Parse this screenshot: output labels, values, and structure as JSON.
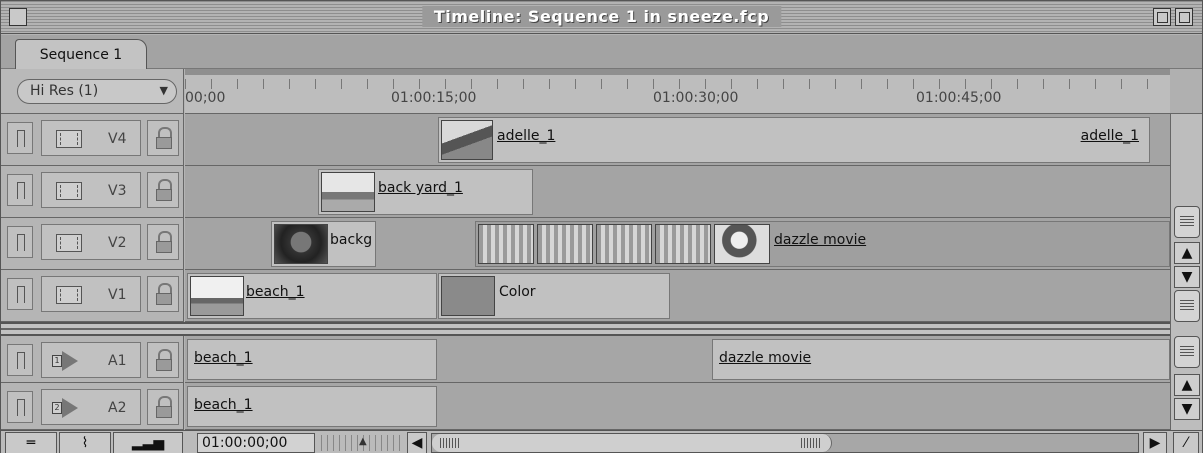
{
  "window": {
    "title": "Timeline: Sequence 1  in sneeze.fcp"
  },
  "tabs": [
    {
      "label": "Sequence 1"
    }
  ],
  "resolution": {
    "label": "Hi Res  (1)",
    "dropdown_icon": "▼"
  },
  "ruler": {
    "timecodes": [
      "00;00",
      "01:00:15;00",
      "01:00:30;00",
      "01:00:45;00"
    ]
  },
  "tracks": {
    "video": [
      {
        "name": "V4",
        "clips": [
          {
            "label": "adelle_1",
            "thumb": "person"
          },
          {
            "label": "adelle_1"
          }
        ]
      },
      {
        "name": "V3",
        "clips": [
          {
            "label": "back yard_1",
            "thumb": "yard"
          }
        ]
      },
      {
        "name": "V2",
        "clips": [
          {
            "label": "backg",
            "thumb": "face"
          },
          {
            "label": "dazzle movie",
            "thumb": "woman"
          }
        ]
      },
      {
        "name": "V1",
        "clips": [
          {
            "label": "beach_1",
            "thumb": "beach"
          },
          {
            "label": "Color",
            "thumb": "color-swatch"
          }
        ]
      }
    ],
    "audio": [
      {
        "name": "A1",
        "channel": "1",
        "clips": [
          {
            "label": "beach_1"
          },
          {
            "label": "dazzle movie"
          }
        ]
      },
      {
        "name": "A2",
        "channel": "2",
        "clips": [
          {
            "label": "beach_1"
          }
        ]
      }
    ]
  },
  "bottom_bar": {
    "timecode": "01:00:00;00",
    "buttons": [
      "track-height-icon",
      "keyframe-overlay-icon",
      "track-size-icon"
    ],
    "scroll_left_icon": "◀",
    "scroll_right_icon": "▶"
  },
  "scroll_icons": {
    "up": "▲",
    "down": "▼"
  }
}
